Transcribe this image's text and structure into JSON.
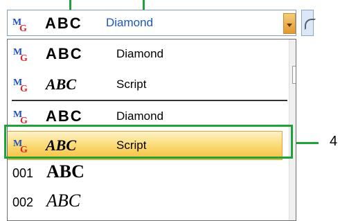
{
  "combo": {
    "mg_badge": "M",
    "mg_badge_sub": "G",
    "preview": "ABC",
    "selected_font": "Diamond",
    "dropdown_arrow_icon": "chevron-down-icon"
  },
  "dropdown": {
    "recent": [
      {
        "preview": "ABC",
        "style": "diamond",
        "name": "Diamond"
      },
      {
        "preview": "ABC",
        "style": "script",
        "name": "Script"
      }
    ],
    "all": [
      {
        "preview": "ABC",
        "style": "diamond",
        "name": "Diamond"
      },
      {
        "preview": "ABC",
        "style": "script",
        "name": "Script",
        "selected": true
      }
    ],
    "numbered": [
      {
        "number": "001",
        "preview": "ABC"
      },
      {
        "number": "002",
        "preview": "ABC"
      }
    ]
  },
  "callout": {
    "label": "4",
    "color": "#1fa23a"
  },
  "colors": {
    "selection_gradient_top": "#fdf3c9",
    "selection_gradient_bottom": "#f5c043",
    "font_name_blue": "#1c56b8",
    "badge_red": "#e0252a",
    "badge_blue": "#1f4fb8"
  }
}
